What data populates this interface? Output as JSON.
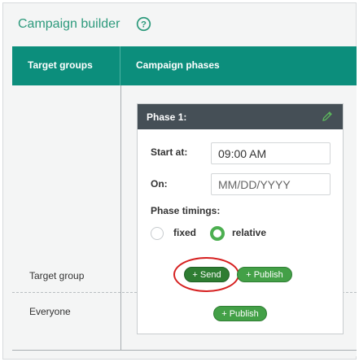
{
  "header": {
    "title": "Campaign builder",
    "help_icon": "question-circle-icon"
  },
  "table": {
    "columns": [
      "Target groups",
      "Campaign phases"
    ],
    "rows": [
      {
        "label": "Target group"
      },
      {
        "label": "Everyone"
      }
    ]
  },
  "phase": {
    "title": "Phase 1:",
    "edit_icon": "pencil-icon",
    "start_label": "Start at:",
    "start_value": "09:00 AM",
    "on_label": "On:",
    "on_placeholder": "MM/DD/YYYY",
    "timings_label": "Phase timings:",
    "timing_options": [
      {
        "label": "fixed",
        "selected": false
      },
      {
        "label": "relative",
        "selected": true
      }
    ]
  },
  "actions": {
    "send_label": "+ Send",
    "publish_label": "+ Publish",
    "everyone_publish_label": "+ Publish"
  },
  "colors": {
    "accent": "#0c8e7c",
    "title_text": "#2d9a7c",
    "phase_header": "#454f56",
    "pill_green": "#2e7d32",
    "highlight_red": "#d62020"
  }
}
